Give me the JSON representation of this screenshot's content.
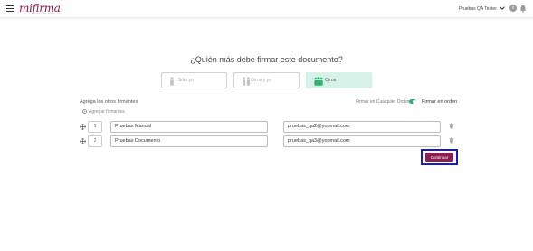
{
  "header": {
    "logo": "mifirma",
    "logo_sub": "Firma Electrónica",
    "user_name": "Pruebas QA Tester",
    "help_symbol": "i"
  },
  "question": "¿Quién más debe firmar este documento?",
  "options": [
    {
      "label": "Sólo yo",
      "icon": "single-person-icon",
      "active": false
    },
    {
      "label": "Otros y yo",
      "icon": "two-people-icon",
      "active": false
    },
    {
      "label": "Otros",
      "icon": "group-icon",
      "active": true
    }
  ],
  "signers_section": {
    "title": "Agrega los otros firmantes",
    "add_label": "Agregar firmantes",
    "order_any_label": "Firmar en Cualquier Orden",
    "order_sequential_label": "Firmar en orden",
    "order_toggle_on": true
  },
  "signers": [
    {
      "order": "1",
      "name": "Pruebas Manual",
      "email": "pruebas_qa2@yopmail.com"
    },
    {
      "order": "2",
      "name": "Pruebas Documento",
      "email": "pruebas_qa3@yopmail.com"
    }
  ],
  "continue_label": "Continuar",
  "colors": {
    "brand": "#8c1f52",
    "active_option_bg": "#d6f1e8",
    "toggle_on": "#2fb36e",
    "highlight_border": "#1a1ac8"
  }
}
